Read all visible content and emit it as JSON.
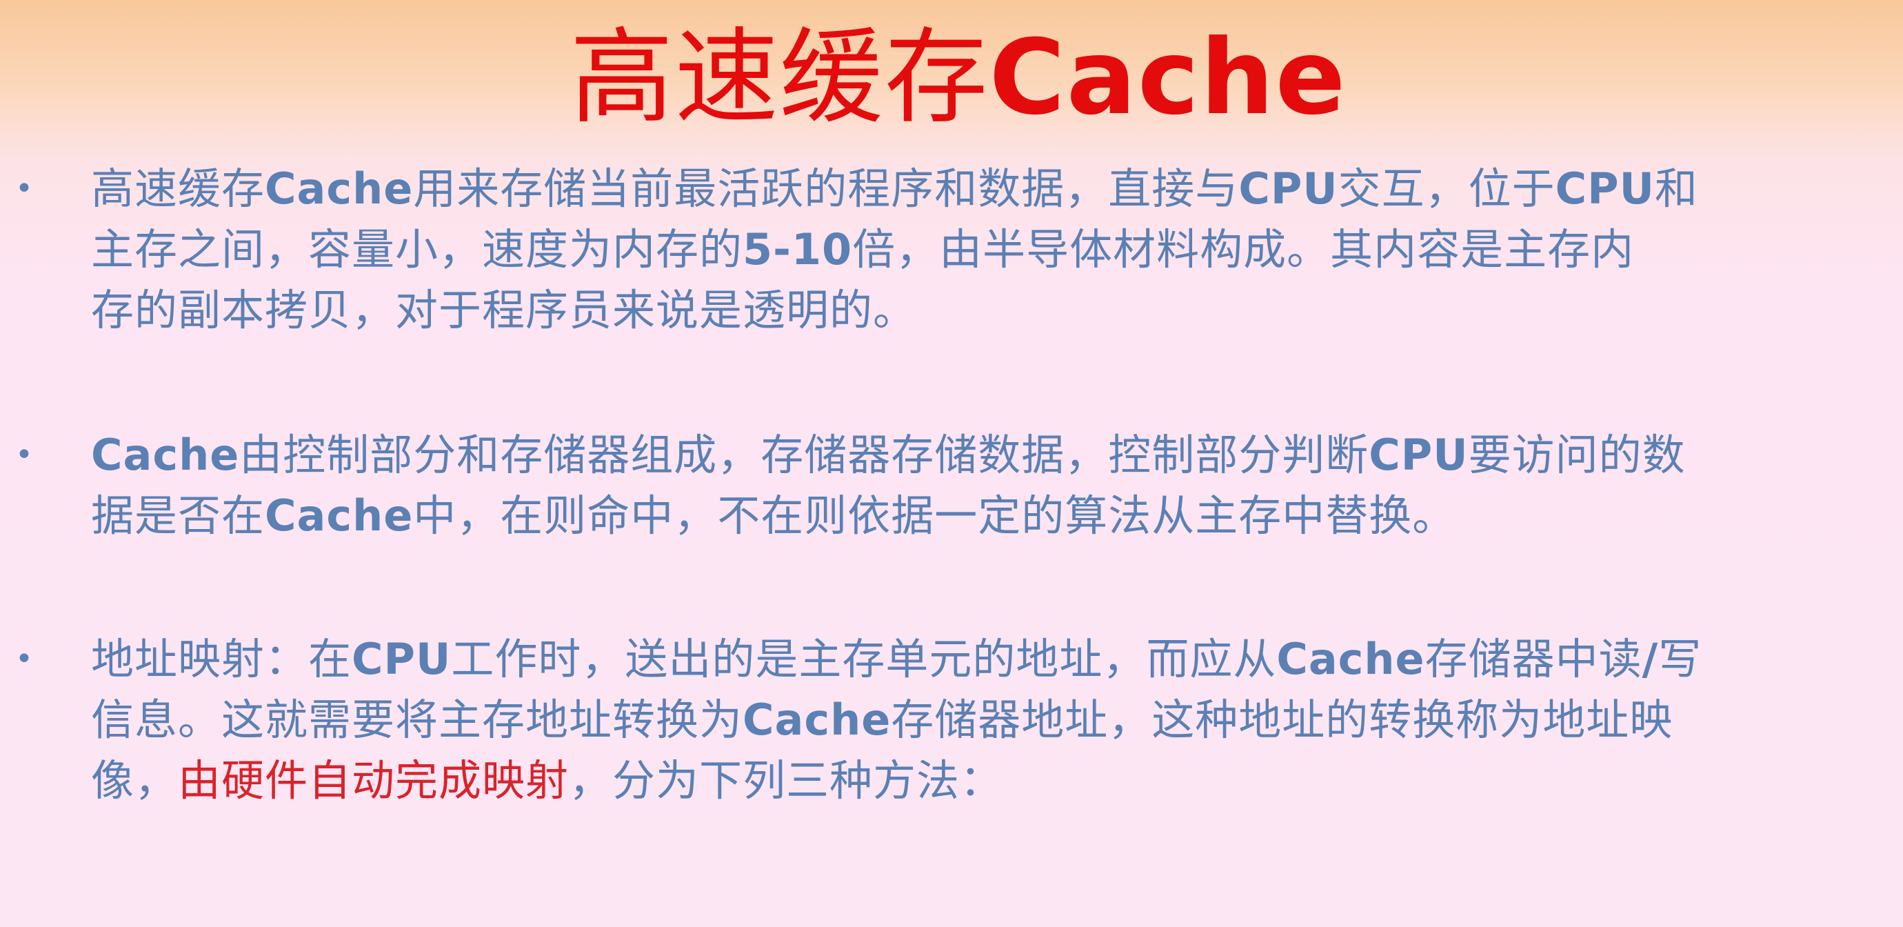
{
  "slide": {
    "title_cn": "高速缓存",
    "title_latin": "Cache",
    "bullets": [
      {
        "marker": "•",
        "lines": [
          "高速缓存Cache用来存储当前最活跃的程序和数据，直接与CPU交互，位于CPU和",
          "主存之间，容量小，速度为内存的5-10倍，由半导体材料构成。其内容是主存内",
          "存的副本拷贝，对于程序员来说是透明的。"
        ]
      },
      {
        "marker": "•",
        "lines": [
          "Cache由控制部分和存储器组成，存储器存储数据，控制部分判断CPU要访问的数",
          "据是否在Cache中，在则命中，不在则依据一定的算法从主存中替换。"
        ]
      },
      {
        "marker": "•",
        "lines": [
          "地址映射：在CPU工作时，送出的是主存单元的地址，而应从Cache存储器中读/写",
          "信息。这就需要将主存地址转换为Cache存储器地址，这种地址的转换称为地址映"
        ],
        "line3_before": "像，",
        "line3_highlight": "由硬件自动完成映射",
        "line3_after": "，分为下列三种方法："
      }
    ]
  },
  "colors": {
    "title": "#e30b0b",
    "body_text": "#5b80b4",
    "highlight": "#d9232b",
    "background_top": "#f9c89a",
    "background_bottom": "#fde6f4"
  }
}
